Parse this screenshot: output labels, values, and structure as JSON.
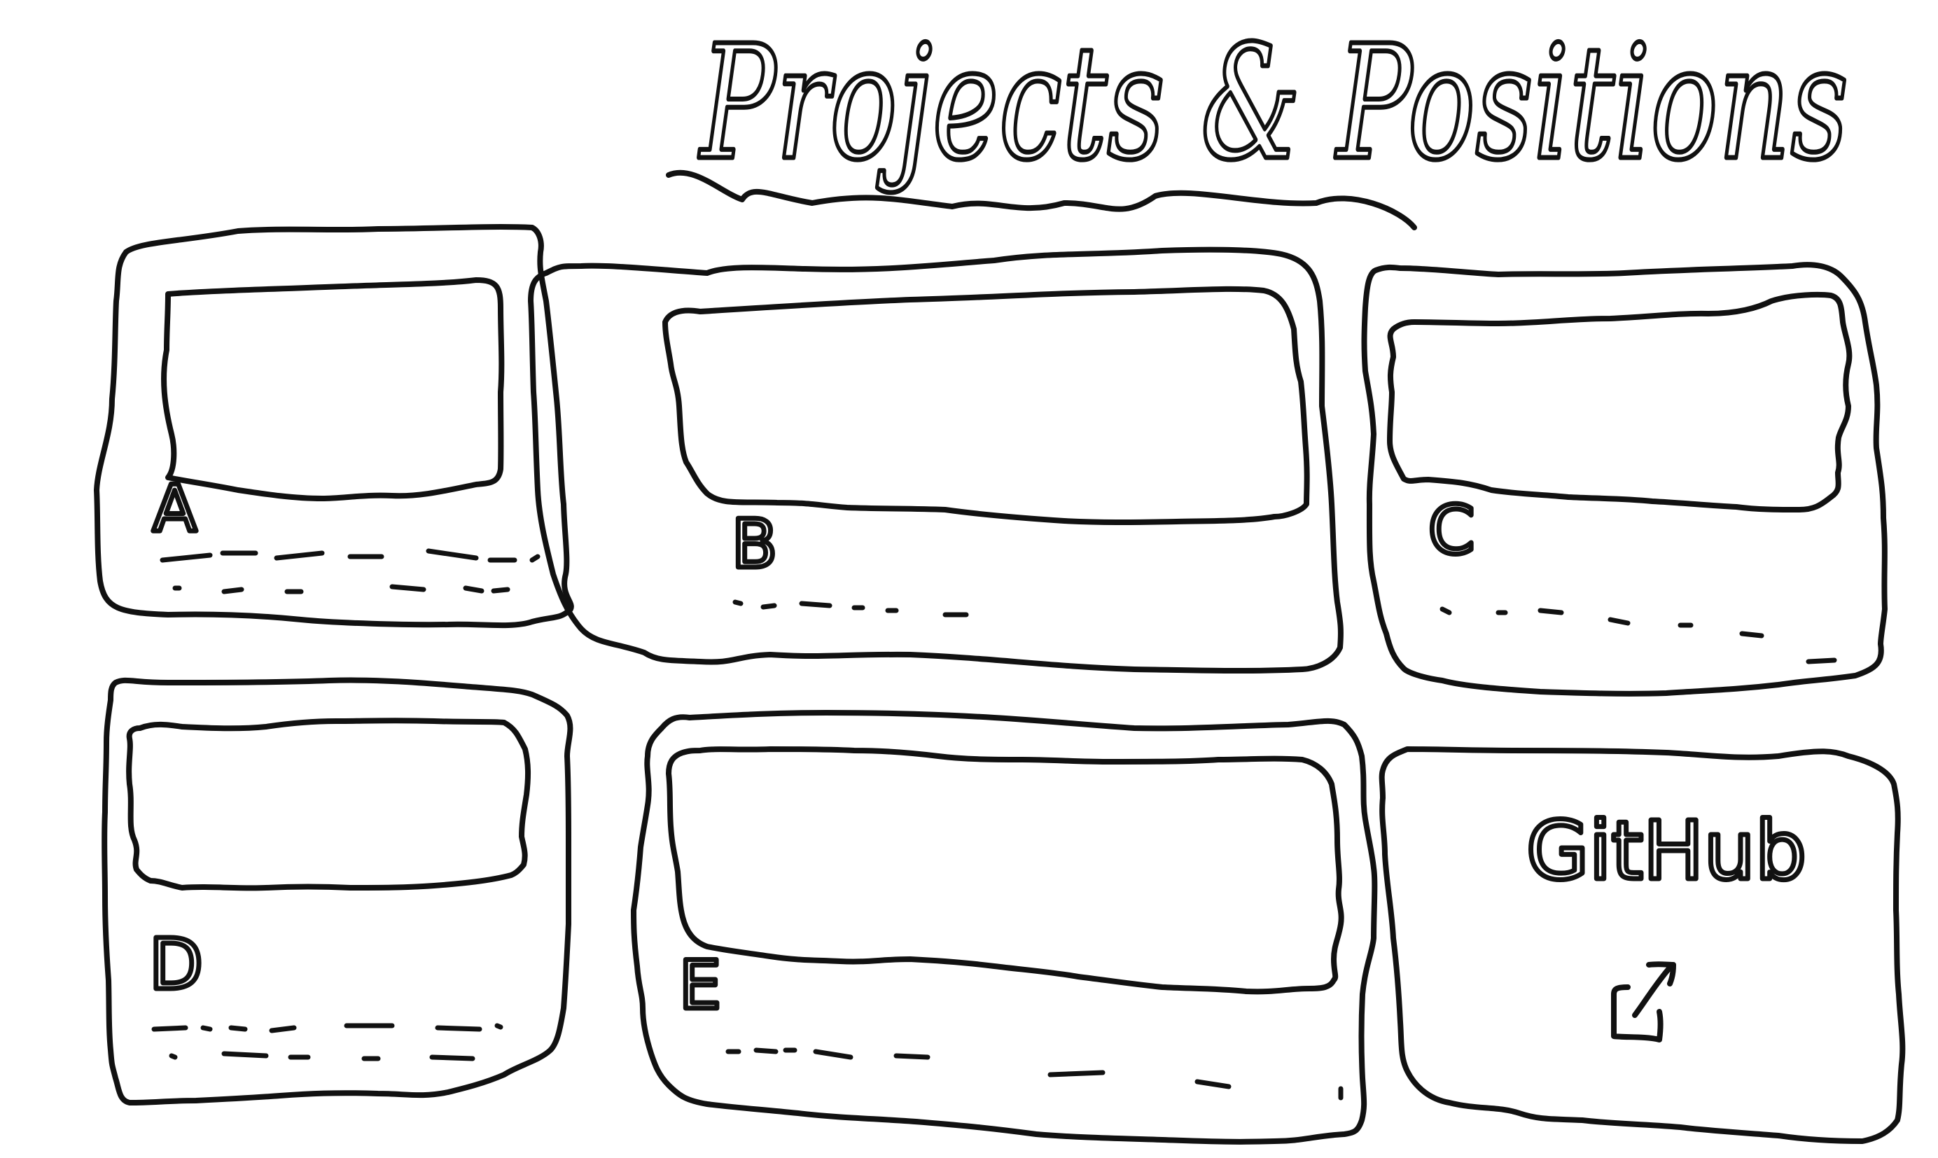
{
  "title": "Projects & Positions",
  "cards": [
    {
      "id": "a",
      "label": "A"
    },
    {
      "id": "b",
      "label": "B"
    },
    {
      "id": "c",
      "label": "C"
    },
    {
      "id": "d",
      "label": "D"
    },
    {
      "id": "e",
      "label": "E"
    }
  ],
  "github_card": {
    "label": "GitHub",
    "icon": "external-link-icon"
  },
  "colors": {
    "ink": "#111111",
    "paper": "#ffffff"
  }
}
